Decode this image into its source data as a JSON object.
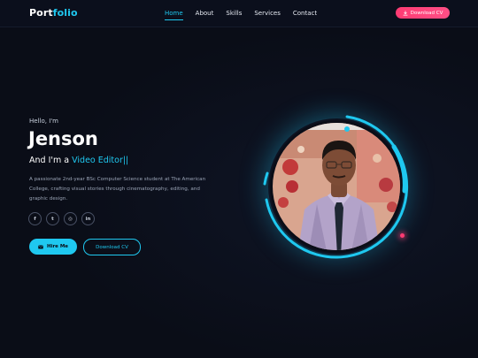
{
  "brand": {
    "part1": "Port",
    "part2": "folio"
  },
  "nav": {
    "items": [
      {
        "label": "Home",
        "active": true
      },
      {
        "label": "About"
      },
      {
        "label": "Skills"
      },
      {
        "label": "Services"
      },
      {
        "label": "Contact"
      }
    ],
    "download_label": "Download CV"
  },
  "hero": {
    "greeting": "Hello, I'm",
    "name": "Jenson",
    "role_prefix": "And I'm a ",
    "role_highlight": "Video Editor||",
    "description": "A passionate 2nd-year BSc Computer Science student at The American College, crafting visual stories through cinematography, editing, and graphic design.",
    "socials": [
      {
        "icon": "facebook-icon",
        "glyph": "f"
      },
      {
        "icon": "twitter-icon",
        "glyph": "t"
      },
      {
        "icon": "instagram-icon",
        "glyph": "◎"
      },
      {
        "icon": "linkedin-icon",
        "glyph": "in"
      }
    ],
    "hire_label": "Hire Me",
    "download_label": "Download CV"
  },
  "colors": {
    "accent": "#1fc8f0",
    "pink": "#ff3b73",
    "background": "#0a0d17"
  }
}
